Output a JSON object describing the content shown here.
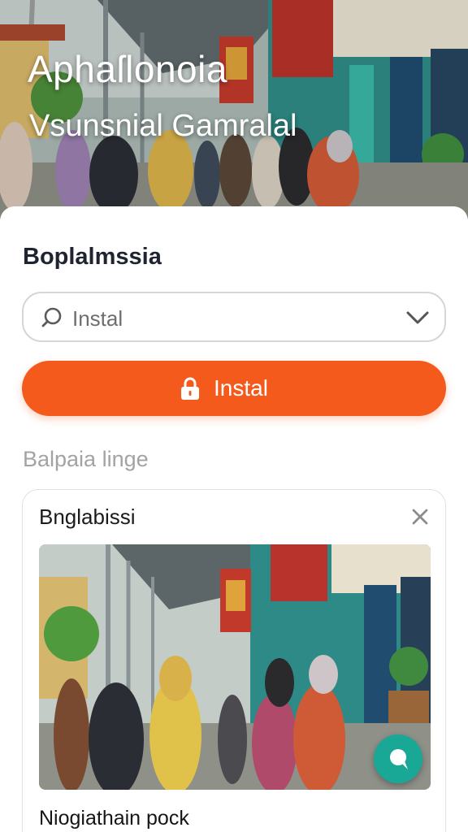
{
  "hero": {
    "title": "Aphaſlonoia",
    "subtitle": "Vsunsnial Gamralal"
  },
  "section": {
    "heading": "Boplalmssia"
  },
  "search": {
    "value": "Instal"
  },
  "install_button": {
    "label": "Instal"
  },
  "subheading": "Balpaia linge",
  "card": {
    "title": "Bnglabissi",
    "caption": "Niogiathain pock"
  },
  "icons": {
    "search": "search-icon",
    "chevron": "chevron-down-icon",
    "lock": "lock-icon",
    "close": "close-icon",
    "fab": "chat-search-icon"
  },
  "colors": {
    "accent": "#f45a1c",
    "fab": "#1aa896",
    "heading": "#1f2430",
    "muted": "#a3a3a3"
  }
}
